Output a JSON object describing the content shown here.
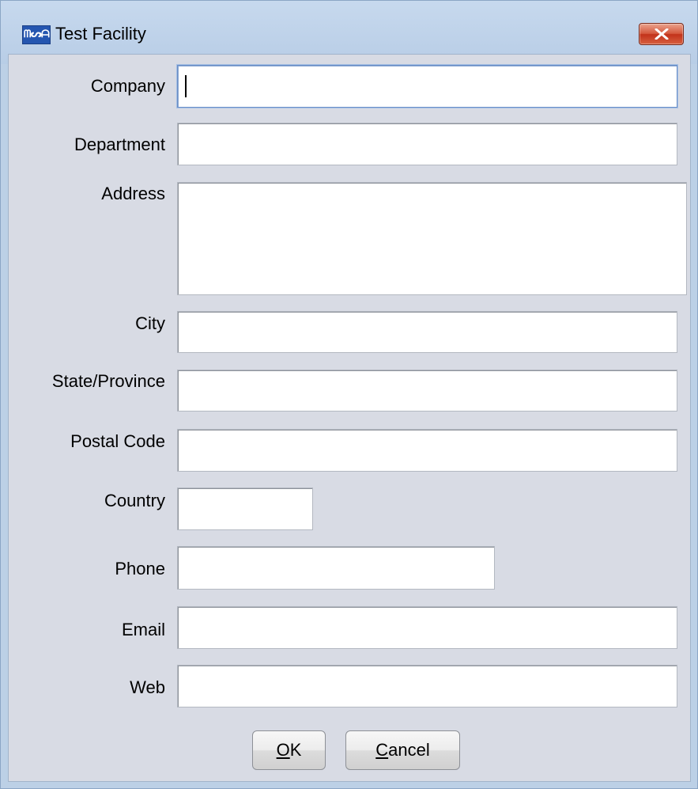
{
  "window": {
    "title": "Test Facility",
    "icon": "app-logo-icon",
    "icon_text": "ᗰᔕᗩ",
    "close_icon": "close-icon"
  },
  "form": {
    "company_label": "Company",
    "company_value": "",
    "department_label": "Department",
    "department_value": "",
    "address_label": "Address",
    "address_value": "",
    "city_label": "City",
    "city_value": "",
    "state_label": "State/Province",
    "state_value": "",
    "postal_label": "Postal Code",
    "postal_value": "",
    "country_label": "Country",
    "country_value": "",
    "phone_label": "Phone",
    "phone_value": "",
    "email_label": "Email",
    "email_value": "",
    "web_label": "Web",
    "web_value": ""
  },
  "buttons": {
    "ok_mnemonic": "O",
    "ok_rest": "K",
    "cancel_mnemonic": "C",
    "cancel_rest": "ancel"
  },
  "colors": {
    "titlebar": "#bcd0e6",
    "client": "#d8dbe4",
    "close_button": "#c8442a",
    "focus_border": "#6a8fc8"
  }
}
